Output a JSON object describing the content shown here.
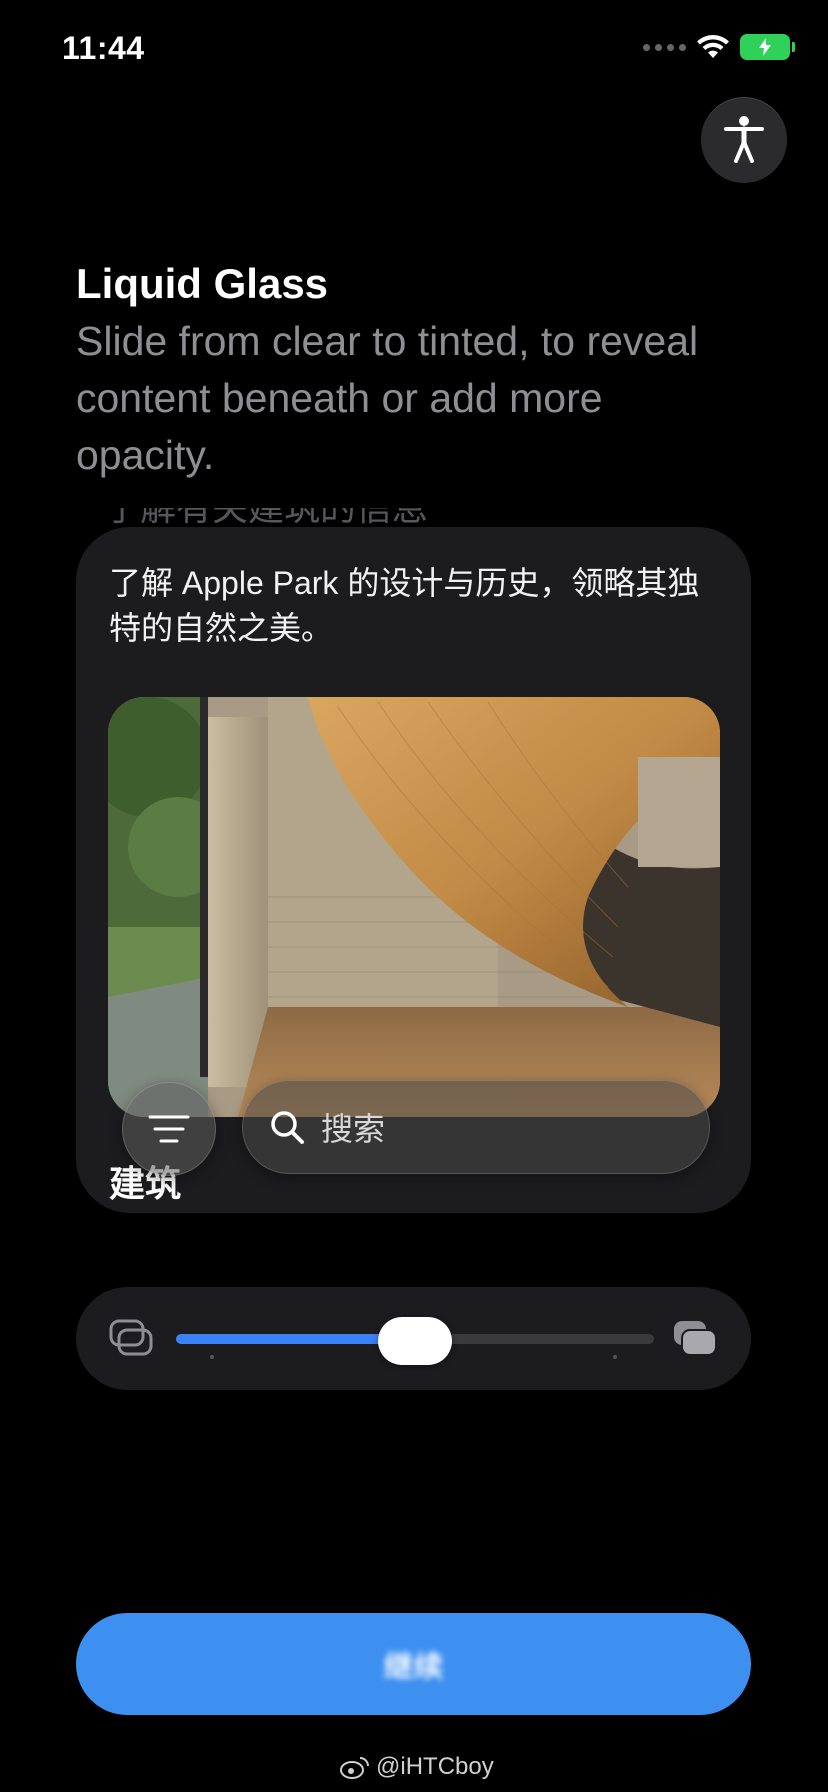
{
  "status_bar": {
    "time": "11:44"
  },
  "header": {
    "title": "Liquid Glass",
    "subtitle": "Slide from clear to tinted, to reveal content beneath or add more opacity."
  },
  "card": {
    "faded_text": "了解有关建筑的信息",
    "description": "了解 Apple Park 的设计与历史，领略其独特的自然之美。",
    "heading": "建筑",
    "search_placeholder": "搜索"
  },
  "slider": {
    "value": 0.5,
    "min_icon": "clear-layers-icon",
    "max_icon": "tinted-layers-icon"
  },
  "continue_button": {
    "label": "继续"
  },
  "watermark": {
    "text": "@iHTCboy"
  },
  "colors": {
    "accent": "#3d8ff0",
    "slider_fill": "#3b82f6",
    "battery": "#30d158",
    "card_bg": "#1c1c1e"
  }
}
